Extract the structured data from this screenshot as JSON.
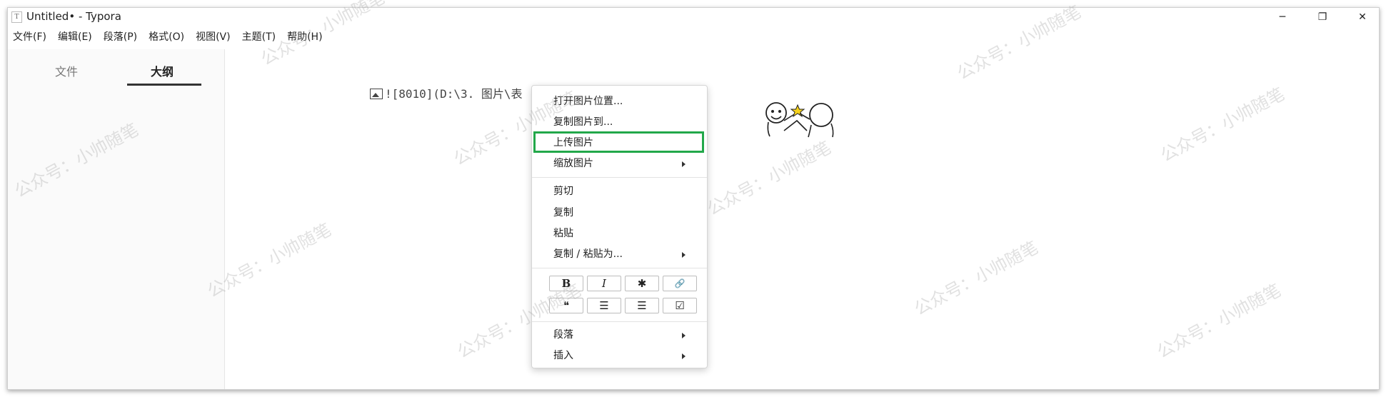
{
  "window": {
    "title": "Untitled• - Typora",
    "app_icon": "T",
    "controls": {
      "minimize": "─",
      "maximize": "❐",
      "close": "✕"
    }
  },
  "menu": [
    "文件(F)",
    "编辑(E)",
    "段落(P)",
    "格式(O)",
    "视图(V)",
    "主题(T)",
    "帮助(H)"
  ],
  "sidebar": {
    "tabs": [
      {
        "label": "文件",
        "active": false
      },
      {
        "label": "大纲",
        "active": true
      }
    ]
  },
  "editor": {
    "line_text": "![8010](D:\\3. 图片\\表"
  },
  "context_menu": {
    "group1": [
      "打开图片位置...",
      "复制图片到...",
      "上传图片",
      "缩放图片"
    ],
    "group2": [
      "剪切",
      "复制",
      "粘贴",
      "复制 / 粘贴为..."
    ],
    "format_buttons_row1": [
      {
        "label": "B",
        "icon": "bold-icon"
      },
      {
        "label": "I",
        "icon": "italic-icon"
      },
      {
        "label": "✱",
        "icon": "asterisk-icon"
      },
      {
        "label": "🔗",
        "icon": "link-icon"
      }
    ],
    "format_buttons_row2": [
      {
        "label": "❝",
        "icon": "quote-icon"
      },
      {
        "label": "☰",
        "icon": "ordered-list-icon"
      },
      {
        "label": "☰",
        "icon": "unordered-list-icon"
      },
      {
        "label": "☑",
        "icon": "task-list-icon"
      }
    ],
    "group3": [
      "段落",
      "插入"
    ],
    "highlighted_item": "上传图片",
    "highlight_color": "#22a84a"
  },
  "watermark": "公众号：小帅随笔"
}
